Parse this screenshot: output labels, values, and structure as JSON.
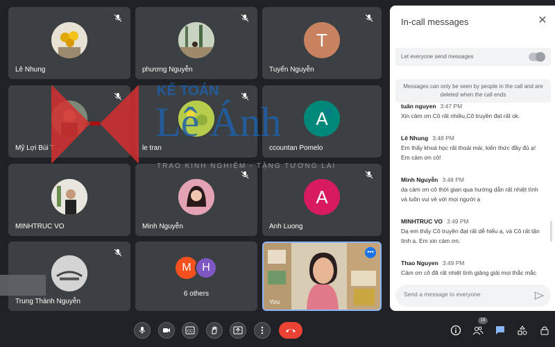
{
  "participants": [
    {
      "name": "Lê Nhung"
    },
    {
      "name": "phương Nguyễn"
    },
    {
      "name": "Tuyển Nguyễn",
      "letter": "T"
    },
    {
      "name": "Mỹ Lợi Bùi T"
    },
    {
      "name": "le tran"
    },
    {
      "name": "ccountan Pomelo",
      "letter": "A"
    },
    {
      "name": "MINHTRUC VO"
    },
    {
      "name": "Minh Nguyễn"
    },
    {
      "name": "Anh Luong",
      "letter": "A"
    },
    {
      "name": "Trung Thành Nguyễn"
    }
  ],
  "others": {
    "label": "6 others",
    "letters": [
      "M",
      "H"
    ]
  },
  "self_tile": {
    "label": "You"
  },
  "panel": {
    "title": "In-call messages",
    "toggle_label": "Let everyone send messages",
    "notice": "Messages can only be seen by people in the call and are deleted when the call ends",
    "messages": [
      {
        "sender": "tuấn nguyen",
        "time": "3:47 PM",
        "text": "Xin cảm ơn Cô rất nhiều,Cô truyền đạt rất ok."
      },
      {
        "sender": "Lê Nhung",
        "time": "3:48 PM",
        "text": "Em thấy khoá học rất thoải mái, kiến thức đầy đủ ạ! Em cảm ơn cô!"
      },
      {
        "sender": "Minh Nguyễn",
        "time": "3:48 PM",
        "text": "dạ cảm ơn cô thời gian qua hướng dẫn rất nhiệt tình và luôn vui vẻ với mọi người ạ"
      },
      {
        "sender": "MINHTRUC VO",
        "time": "3:49 PM",
        "text": "Dạ em thấy Cô truyền đạt rất dễ hiểu ạ, và Cô rất tận tình ạ. Em xin cảm ơn."
      },
      {
        "sender": "Thao Nguyen",
        "time": "3:49 PM",
        "text": "Cảm ơn cô đã rất nhiệt tình giảng giải mọi thắc mắc"
      }
    ],
    "input_placeholder": "Send a message to everyone"
  },
  "controls": {
    "participant_count": "19"
  },
  "watermark": {
    "top": "KẾ TOÁN",
    "main": "Lê Ánh",
    "sub": "TRAO KINH NGHIỆM - TẶNG TƯƠNG LAI",
    "reg": "®"
  },
  "colors": {
    "accent": "#1a73e8",
    "end_call": "#ea4335",
    "avatar_t": "#c8825f",
    "avatar_a1": "#00897b",
    "avatar_a2": "#d81b60",
    "avatar_m": "#f4511e",
    "avatar_h": "#7e57c2",
    "brand_red": "#d32f2f",
    "brand_blue": "#1f5fa8"
  }
}
